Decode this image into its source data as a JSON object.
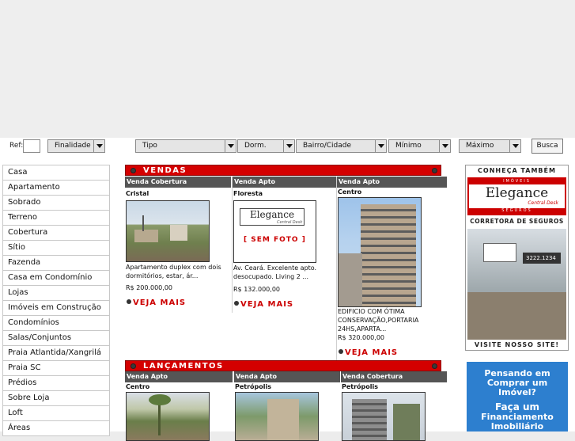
{
  "search": {
    "ref_label": "Ref:",
    "ref_value": "",
    "finalidade": "Finalidade",
    "tipo": "Tipo",
    "dorm": "Dorm.",
    "bairro": "Bairro/Cidade",
    "minimo": "Mínimo",
    "maximo": "Máximo",
    "busca": "Busca"
  },
  "menu": [
    "Casa",
    "Apartamento",
    "Sobrado",
    "Terreno",
    "Cobertura",
    "Sítio",
    "Fazenda",
    "Casa em Condomínio",
    "Lojas",
    "Imóveis em Construção",
    "Condomínios",
    "Salas/Conjuntos",
    "Praia Atlantida/Xangrilá",
    "Praia SC",
    "Prédios",
    "Sobre Loja",
    "Loft",
    "Áreas"
  ],
  "vendas": {
    "title": "VENDAS",
    "cards": [
      {
        "type": "Venda Cobertura",
        "location": "Cristal",
        "desc1": "Apartamento duplex com dois",
        "desc2": "dormitórios, estar, ár...",
        "desc3": "",
        "desc4": "",
        "price": "R$ 200.000,00",
        "more": "VEJA MAIS"
      },
      {
        "type": "Venda Apto",
        "location": "Floresta",
        "desc1": "Av. Ceará. Excelente apto.",
        "desc2": "desocupado. Living 2 ...",
        "desc3": "",
        "desc4": "",
        "price": "R$ 132.000,00",
        "more": "VEJA MAIS",
        "nophoto_brand": "Elegance",
        "nophoto_sub": "Central Desk",
        "nophoto_label": "[ SEM FOTO ]"
      },
      {
        "type": "Venda Apto",
        "location": "Centro",
        "desc1": "EDIFICIO COM ÓTIMA",
        "desc2": "CONSERVAÇÃO,PORTARIA",
        "desc3": "24HS,APARTA...",
        "desc4": "",
        "price": "R$ 320.000,00",
        "more": "VEJA MAIS"
      }
    ]
  },
  "lancamentos": {
    "title": "LANÇAMENTOS",
    "cards": [
      {
        "type": "Venda Apto",
        "location": "Centro"
      },
      {
        "type": "Venda Apto",
        "location": "Petrópolis"
      },
      {
        "type": "Venda Cobertura",
        "location": "Petrópolis"
      }
    ]
  },
  "side_ad": {
    "top": "CONHEÇA TAMBÉM",
    "brand": "Elegance",
    "brand_top": "IMÓVEIS",
    "brand_sub": "Central Desk",
    "brand_bottom": "SEGUROS",
    "line": "CORRETORA DE SEGUROS",
    "phone": "3222.1234",
    "bottom": "VISITE NOSSO SITE!"
  },
  "side_ad2": {
    "l1": "Pensando em",
    "l2": "Comprar um",
    "l3": "Imóvel?",
    "l4": "Faça um",
    "l5": "Financiamento",
    "l6": "Imobiliário"
  },
  "colors": {
    "accent": "#d40000",
    "card_header": "#555555",
    "ad_blue": "#2d7fcf"
  }
}
